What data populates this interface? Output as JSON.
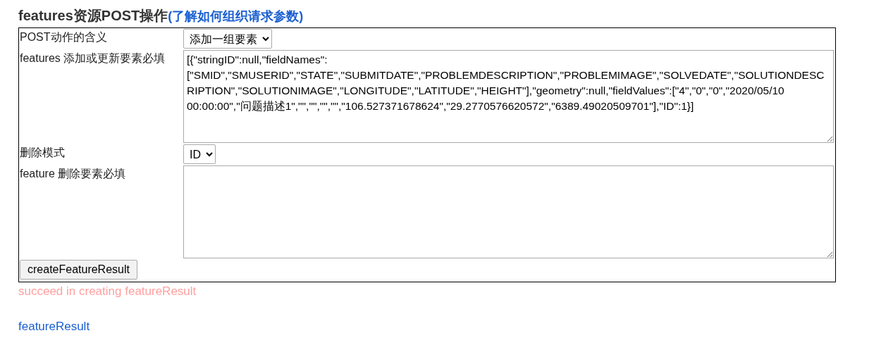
{
  "heading": {
    "title": "features资源POST操作",
    "help_link": "(了解如何组织请求参数)"
  },
  "form": {
    "rows": [
      {
        "kind": "select",
        "label": "POST动作的含义",
        "value": "添加一组要素"
      },
      {
        "kind": "textarea",
        "label": "features 添加或更新要素必填",
        "value": "[{\"stringID\":null,\"fieldNames\":[\"SMID\",\"SMUSERID\",\"STATE\",\"SUBMITDATE\",\"PROBLEMDESCRIPTION\",\"PROBLEMIMAGE\",\"SOLVEDATE\",\"SOLUTIONDESCRIPTION\",\"SOLUTIONIMAGE\",\"LONGITUDE\",\"LATITUDE\",\"HEIGHT\"],\"geometry\":null,\"fieldValues\":[\"4\",\"0\",\"0\",\"2020/05/10 00:00:00\",\"问题描述1\",\"\",\"\",\"\",\"\",\"106.527371678624\",\"29.2770576620572\",\"6389.49020509701\"],\"ID\":1}]"
      },
      {
        "kind": "select",
        "label": "删除模式",
        "value": "ID"
      },
      {
        "kind": "textarea",
        "label": "feature 删除要素必填",
        "value": ""
      }
    ],
    "submit_button": "createFeatureResult"
  },
  "status_message": "succeed in creating featureResult",
  "result_link": "featureResult"
}
